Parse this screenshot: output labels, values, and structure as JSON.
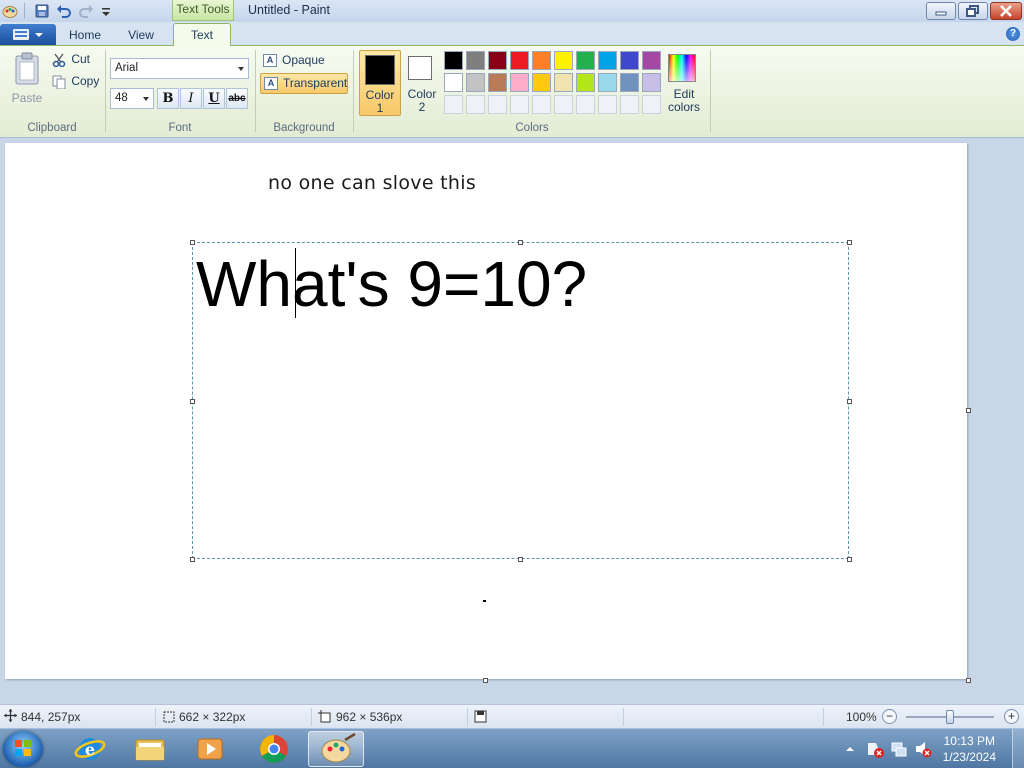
{
  "window": {
    "title": "Untitled - Paint",
    "contextual_tab": "Text Tools"
  },
  "tabs": [
    {
      "label": "Home",
      "active": false
    },
    {
      "label": "View",
      "active": false
    },
    {
      "label": "Text",
      "active": true
    }
  ],
  "ribbon": {
    "clipboard": {
      "label": "Clipboard",
      "paste": "Paste",
      "cut": "Cut",
      "copy": "Copy"
    },
    "font": {
      "label": "Font",
      "family": "Arial",
      "size": "48",
      "bold": "B",
      "italic": "I",
      "underline": "U",
      "strikethrough": "abc"
    },
    "background": {
      "label": "Background",
      "opaque": "Opaque",
      "transparent": "Transparent",
      "selected": "Transparent"
    },
    "colors": {
      "label": "Colors",
      "color1_label": "Color\n1",
      "color1_line1": "Color",
      "color1_line2": "1",
      "color1": "#000000",
      "color2_line1": "Color",
      "color2_line2": "2",
      "color2": "#ffffff",
      "palette_row1": [
        "#000000",
        "#7f7f7f",
        "#880015",
        "#ed1c24",
        "#ff7f27",
        "#fff200",
        "#22b14c",
        "#00a2e8",
        "#3f48cc",
        "#a349a4"
      ],
      "palette_row2": [
        "#ffffff",
        "#c3c3c3",
        "#b97a57",
        "#ffaec9",
        "#ffc90e",
        "#efe4b0",
        "#b5e61d",
        "#99d9ea",
        "#7092be",
        "#c8bfe7"
      ],
      "edit_line1": "Edit",
      "edit_line2": "colors"
    }
  },
  "canvas": {
    "small_text": "no one can slove this",
    "big_text": "What's 9=10?"
  },
  "statusbar": {
    "cursor_pos": "844, 257px",
    "selection_size": "662 × 322px",
    "canvas_size": "962 × 536px",
    "zoom": "100%"
  },
  "taskbar": {
    "time": "10:13 PM",
    "date": "1/23/2024"
  }
}
